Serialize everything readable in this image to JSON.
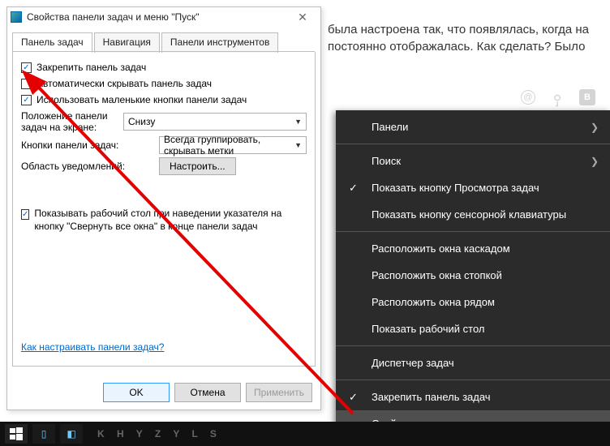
{
  "bg_text_line1": "была настроена так, что появлялась, когда на",
  "bg_text_line2": "постоянно отображалась. Как сделать? Было",
  "dialog": {
    "title": "Свойства панели задач и меню \"Пуск\"",
    "tabs": {
      "t0": "Панель задач",
      "t1": "Навигация",
      "t2": "Панели инструментов"
    },
    "chk_pin": "Закрепить панель задач",
    "chk_autohide": "Автоматически скрывать панель задач",
    "chk_smallicons": "Использовать маленькие кнопки панели задач",
    "label_position": "Положение панели задач на экране:",
    "combo_position": "Снизу",
    "label_buttons": "Кнопки панели задач:",
    "combo_buttons": "Всегда группировать, скрывать метки",
    "label_notify": "Область уведомлений:",
    "btn_customize": "Настроить...",
    "chk_aero": "Показывать рабочий стол при наведении указателя на кнопку \"Свернуть все окна\" в конце панели задач",
    "help_link": "Как настраивать панели задач?",
    "btn_ok": "OK",
    "btn_cancel": "Отмена",
    "btn_apply": "Применить"
  },
  "ctx": {
    "panels": "Панели",
    "search": "Поиск",
    "taskview": "Показать кнопку Просмотра задач",
    "touchkb": "Показать кнопку сенсорной клавиатуры",
    "cascade": "Расположить окна каскадом",
    "stack": "Расположить окна стопкой",
    "sidebyside": "Расположить окна рядом",
    "showdesktop": "Показать рабочий стол",
    "taskmgr": "Диспетчер задач",
    "lock": "Закрепить панель задач",
    "properties": "Свойства"
  },
  "wallpaper": "K   H   Y   Z   Y   L       S"
}
